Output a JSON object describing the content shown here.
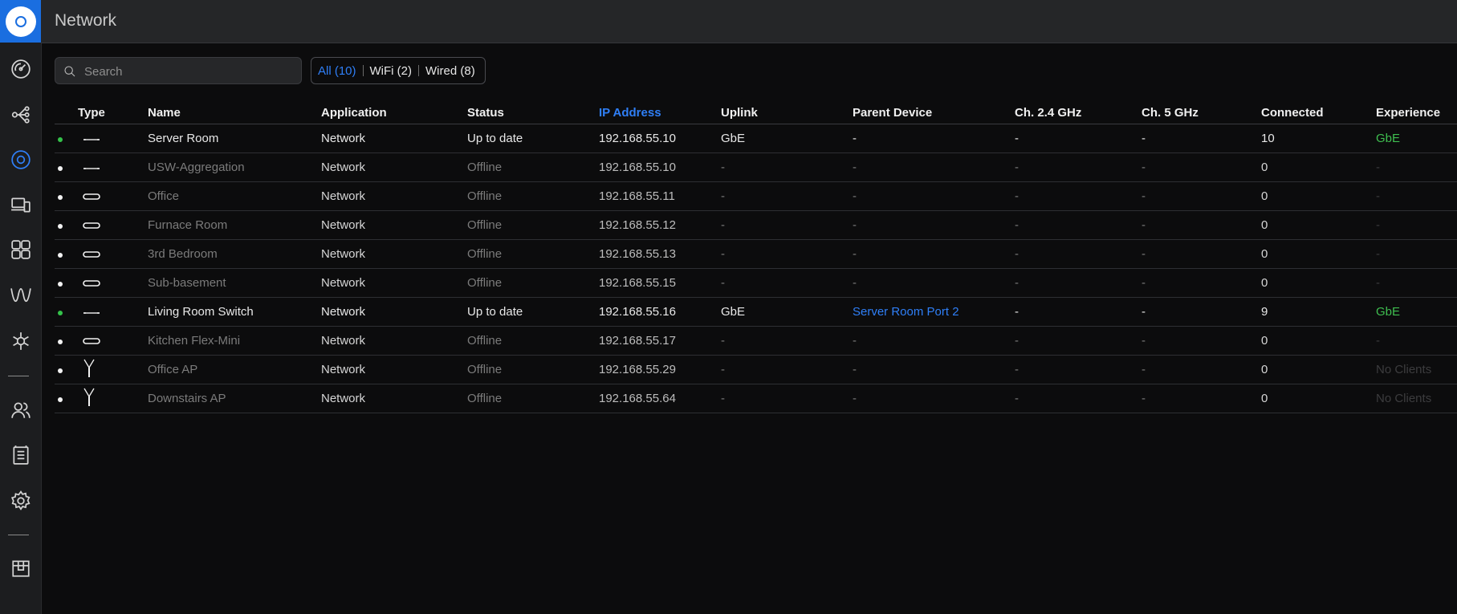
{
  "app": {
    "page_title": "Network",
    "brand_color": "#1a6ee0",
    "accent_color": "#2f7ff7",
    "good_color": "#3fbf50"
  },
  "sidebar": {
    "items": [
      {
        "icon": "dashboard-icon"
      },
      {
        "icon": "topology-icon"
      },
      {
        "icon": "devices-icon",
        "active": true
      },
      {
        "icon": "clients-icon"
      },
      {
        "icon": "statistics-icon"
      },
      {
        "icon": "insights-icon"
      },
      {
        "icon": "hotspot-icon"
      },
      {
        "icon": "users-icon"
      },
      {
        "icon": "logs-icon"
      },
      {
        "icon": "settings-icon"
      },
      {
        "icon": "shop-icon"
      }
    ]
  },
  "search": {
    "placeholder": "Search",
    "value": ""
  },
  "filters": [
    {
      "label": "All (10)",
      "active": true
    },
    {
      "label": "WiFi (2)",
      "active": false
    },
    {
      "label": "Wired (8)",
      "active": false
    }
  ],
  "table": {
    "columns": [
      "Type",
      "Name",
      "Application",
      "Status",
      "IP Address",
      "Uplink",
      "Parent Device",
      "Ch. 2.4 GHz",
      "Ch. 5 GHz",
      "Connected",
      "Experience"
    ],
    "sorted_column": "IP Address",
    "rows": [
      {
        "state": "online",
        "device": "switch-icon",
        "name": "Server Room",
        "application": "Network",
        "status": "Up to date",
        "ip": "192.168.55.10",
        "uplink": "GbE",
        "parent": "-",
        "parent_link": false,
        "ch24": "-",
        "ch5": "-",
        "connected": "10",
        "experience": "GbE",
        "exp_kind": "good"
      },
      {
        "state": "offline",
        "device": "switch-icon",
        "name": "USW-Aggregation",
        "application": "Network",
        "status": "Offline",
        "ip": "192.168.55.10",
        "uplink": "-",
        "parent": "-",
        "parent_link": false,
        "ch24": "-",
        "ch5": "-",
        "connected": "0",
        "experience": "-",
        "exp_kind": "none"
      },
      {
        "state": "offline",
        "device": "flex-mini-icon",
        "name": "Office",
        "application": "Network",
        "status": "Offline",
        "ip": "192.168.55.11",
        "uplink": "-",
        "parent": "-",
        "parent_link": false,
        "ch24": "-",
        "ch5": "-",
        "connected": "0",
        "experience": "-",
        "exp_kind": "none"
      },
      {
        "state": "offline",
        "device": "flex-mini-icon",
        "name": "Furnace Room",
        "application": "Network",
        "status": "Offline",
        "ip": "192.168.55.12",
        "uplink": "-",
        "parent": "-",
        "parent_link": false,
        "ch24": "-",
        "ch5": "-",
        "connected": "0",
        "experience": "-",
        "exp_kind": "none"
      },
      {
        "state": "offline",
        "device": "flex-mini-icon",
        "name": "3rd Bedroom",
        "application": "Network",
        "status": "Offline",
        "ip": "192.168.55.13",
        "uplink": "-",
        "parent": "-",
        "parent_link": false,
        "ch24": "-",
        "ch5": "-",
        "connected": "0",
        "experience": "-",
        "exp_kind": "none"
      },
      {
        "state": "offline",
        "device": "flex-mini-icon",
        "name": "Sub-basement",
        "application": "Network",
        "status": "Offline",
        "ip": "192.168.55.15",
        "uplink": "-",
        "parent": "-",
        "parent_link": false,
        "ch24": "-",
        "ch5": "-",
        "connected": "0",
        "experience": "-",
        "exp_kind": "none"
      },
      {
        "state": "online",
        "device": "switch-icon",
        "name": "Living Room Switch",
        "application": "Network",
        "status": "Up to date",
        "ip": "192.168.55.16",
        "uplink": "GbE",
        "parent": "Server Room Port 2",
        "parent_link": true,
        "ch24": "-",
        "ch5": "-",
        "connected": "9",
        "experience": "GbE",
        "exp_kind": "good"
      },
      {
        "state": "offline",
        "device": "flex-mini-icon",
        "name": "Kitchen Flex-Mini",
        "application": "Network",
        "status": "Offline",
        "ip": "192.168.55.17",
        "uplink": "-",
        "parent": "-",
        "parent_link": false,
        "ch24": "-",
        "ch5": "-",
        "connected": "0",
        "experience": "-",
        "exp_kind": "none"
      },
      {
        "state": "offline",
        "device": "access-point-icon",
        "name": "Office AP",
        "application": "Network",
        "status": "Offline",
        "ip": "192.168.55.29",
        "uplink": "-",
        "parent": "-",
        "parent_link": false,
        "ch24": "-",
        "ch5": "-",
        "connected": "0",
        "experience": "No Clients",
        "exp_kind": "none"
      },
      {
        "state": "offline",
        "device": "access-point-icon",
        "name": "Downstairs AP",
        "application": "Network",
        "status": "Offline",
        "ip": "192.168.55.64",
        "uplink": "-",
        "parent": "-",
        "parent_link": false,
        "ch24": "-",
        "ch5": "-",
        "connected": "0",
        "experience": "No Clients",
        "exp_kind": "none"
      }
    ]
  }
}
